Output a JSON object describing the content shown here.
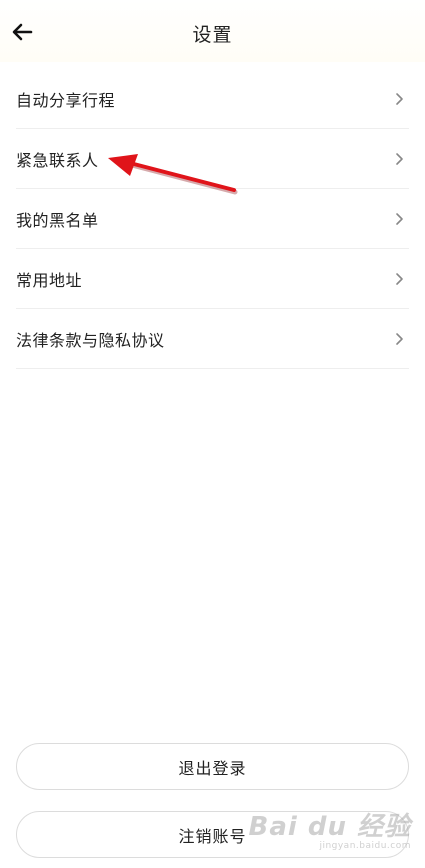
{
  "header": {
    "title": "设置",
    "back_icon": "arrow-left-icon"
  },
  "menu": {
    "items": [
      {
        "label": "自动分享行程"
      },
      {
        "label": "紧急联系人"
      },
      {
        "label": "我的黑名单"
      },
      {
        "label": "常用地址"
      },
      {
        "label": "法律条款与隐私协议"
      }
    ],
    "chevron_icon": "chevron-right-icon"
  },
  "actions": {
    "logout_label": "退出登录",
    "cancel_account_label": "注销账号"
  },
  "annotation": {
    "arrow_color": "#e0141a"
  },
  "watermark": {
    "brand": "Bai du 经验",
    "url": "jingyan.baidu.com"
  }
}
